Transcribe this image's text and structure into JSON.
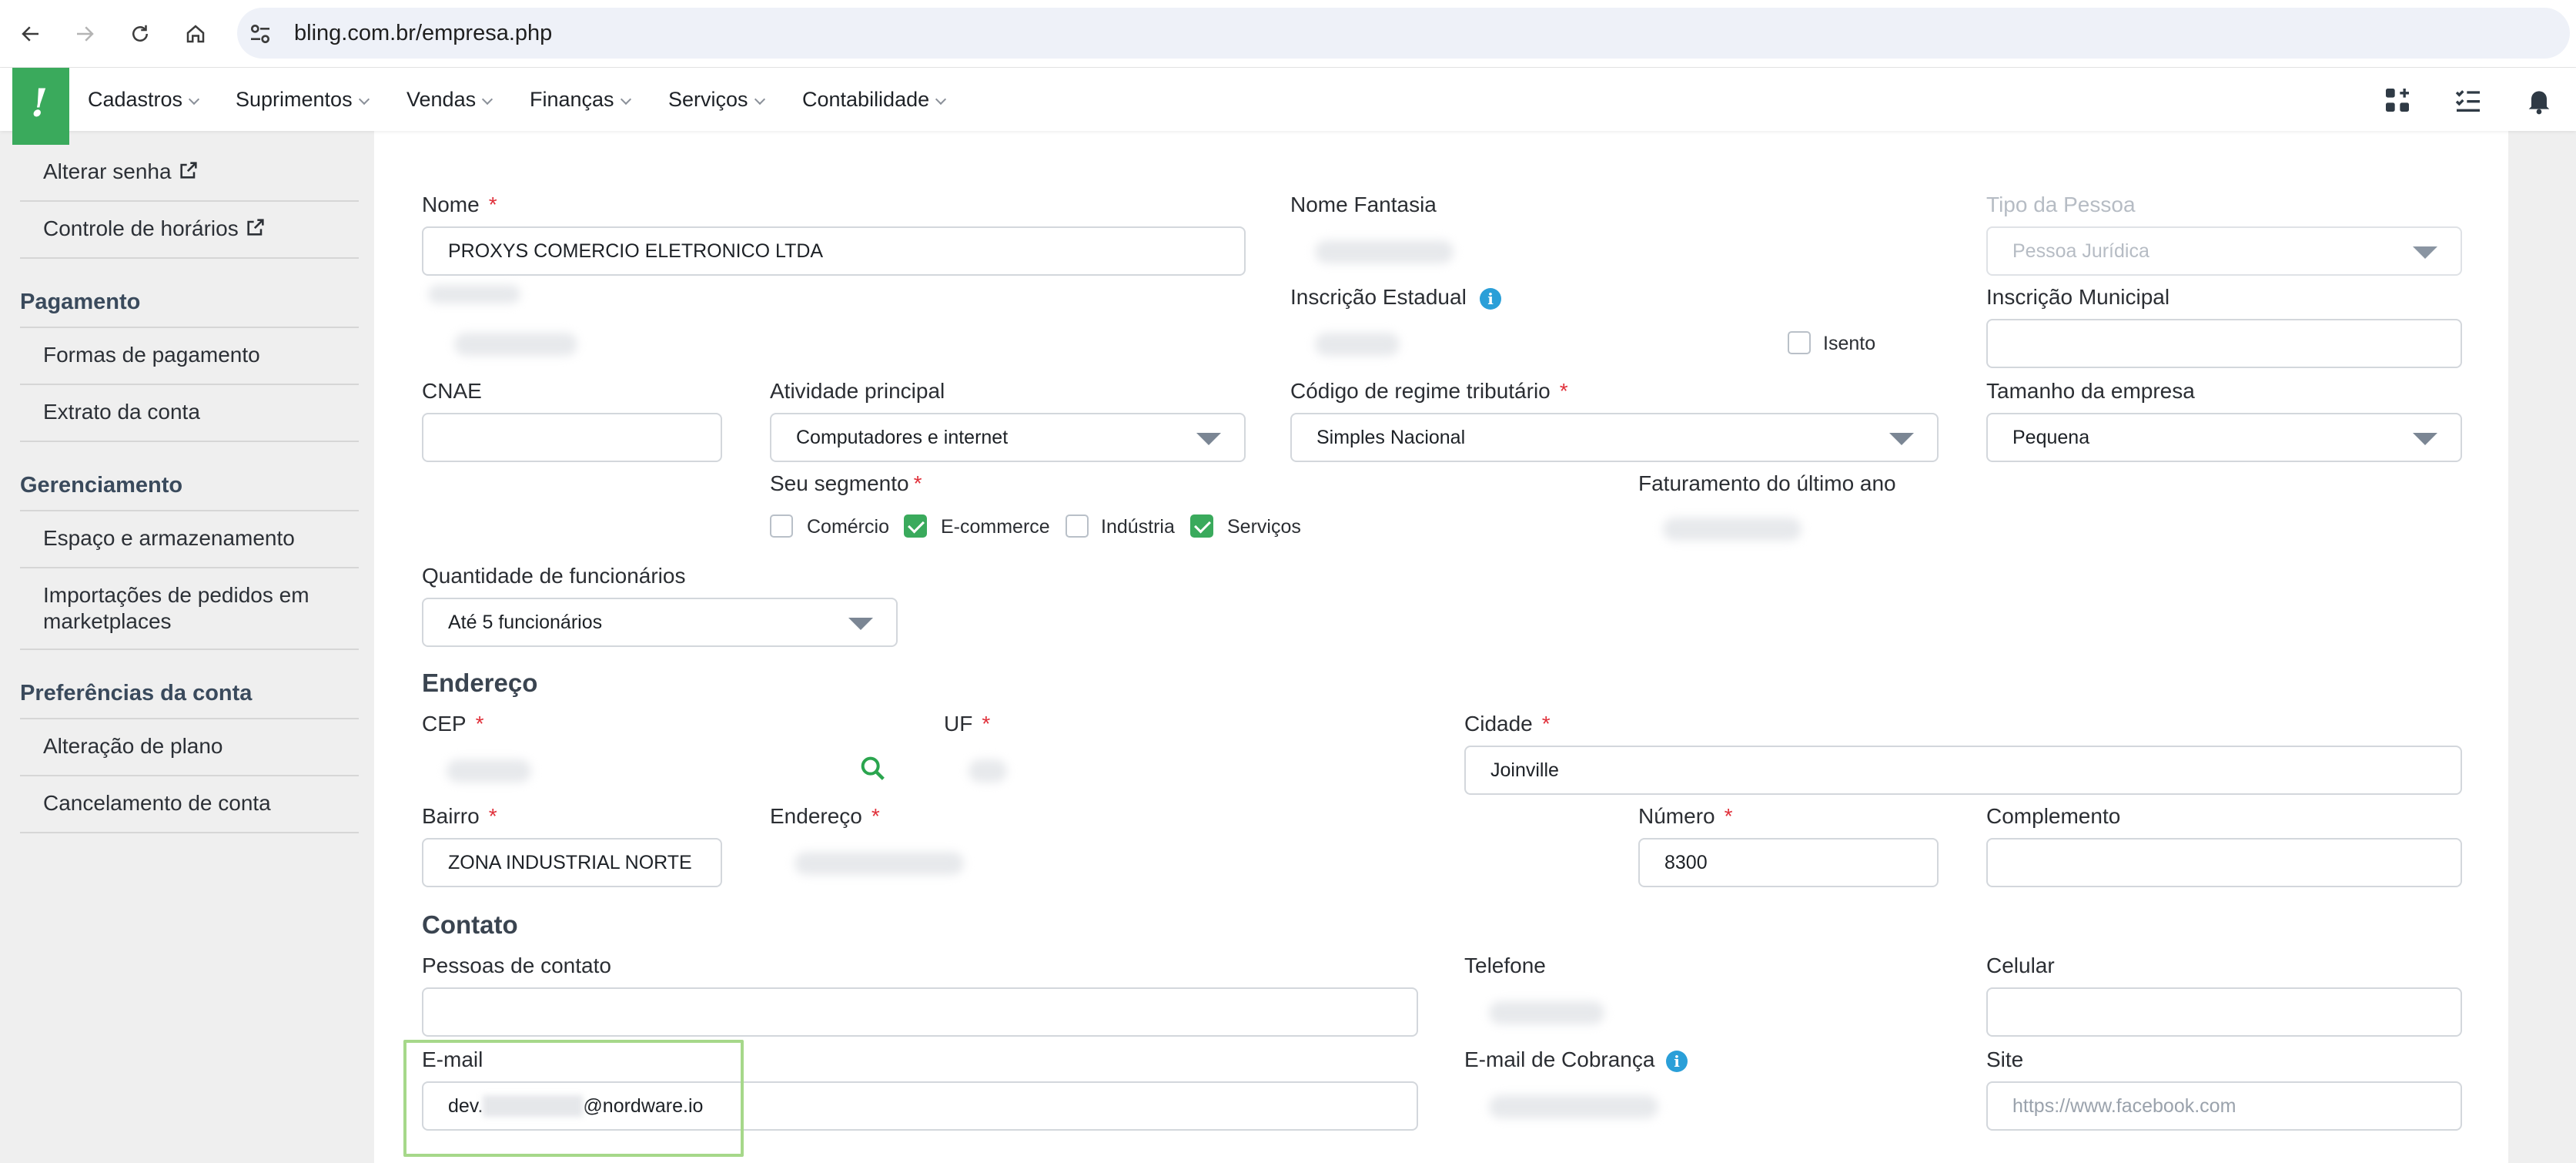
{
  "browser": {
    "url": "bling.com.br/empresa.php"
  },
  "nav": {
    "menu": [
      "Cadastros",
      "Suprimentos",
      "Vendas",
      "Finanças",
      "Serviços",
      "Contabilidade"
    ],
    "accent": "#3aaa5c"
  },
  "sidebar": {
    "items_top": [
      "Alterar senha",
      "Controle de horários"
    ],
    "pagamento": {
      "heading": "Pagamento",
      "items": [
        "Formas de pagamento",
        "Extrato da conta"
      ]
    },
    "gerenciamento": {
      "heading": "Gerenciamento",
      "items": [
        "Espaço e armazenamento",
        "Importações de pedidos em",
        "marketplaces"
      ]
    },
    "preferencias": {
      "heading": "Preferências da conta",
      "items": [
        "Alteração de plano",
        "Cancelamento de conta"
      ]
    }
  },
  "form": {
    "required_mark": "*",
    "nome": {
      "label": "Nome",
      "value": "PROXYS COMERCIO ELETRONICO LTDA"
    },
    "nome_fantasia": {
      "label": "Nome Fantasia"
    },
    "tipo_pessoa": {
      "label": "Tipo da Pessoa",
      "value": "Pessoa Jurídica"
    },
    "inscricao_estadual": {
      "label": "Inscrição Estadual",
      "isento_label": "Isento",
      "isento_checked": false
    },
    "inscricao_municipal": {
      "label": "Inscrição Municipal",
      "value": ""
    },
    "cnae": {
      "label": "CNAE",
      "value": ""
    },
    "atividade": {
      "label": "Atividade principal",
      "value": "Computadores e internet"
    },
    "regime": {
      "label": "Código de regime tributário",
      "value": "Simples Nacional"
    },
    "tamanho": {
      "label": "Tamanho da empresa",
      "value": "Pequena"
    },
    "segmento": {
      "label": "Seu segmento",
      "options": [
        {
          "label": "Comércio",
          "checked": false
        },
        {
          "label": "E-commerce",
          "checked": true
        },
        {
          "label": "Indústria",
          "checked": false
        },
        {
          "label": "Serviços",
          "checked": true
        }
      ]
    },
    "faturamento": {
      "label": "Faturamento do último ano"
    },
    "funcionarios": {
      "label": "Quantidade de funcionários",
      "value": "Até 5 funcionários"
    }
  },
  "endereco": {
    "heading": "Endereço",
    "cep": {
      "label": "CEP"
    },
    "uf": {
      "label": "UF"
    },
    "cidade": {
      "label": "Cidade",
      "value": "Joinville"
    },
    "bairro": {
      "label": "Bairro",
      "value": "ZONA INDUSTRIAL NORTE"
    },
    "endereco": {
      "label": "Endereço"
    },
    "numero": {
      "label": "Número",
      "value": "8300"
    },
    "complemento": {
      "label": "Complemento",
      "value": ""
    }
  },
  "contato": {
    "heading": "Contato",
    "pessoas": {
      "label": "Pessoas de contato",
      "value": ""
    },
    "telefone": {
      "label": "Telefone"
    },
    "celular": {
      "label": "Celular",
      "value": ""
    },
    "email": {
      "label": "E-mail",
      "value_prefix": "dev.",
      "value_suffix": "@nordware.io"
    },
    "email_cobranca": {
      "label": "E-mail de Cobrança"
    },
    "site": {
      "label": "Site",
      "placeholder": "https://www.facebook.com"
    }
  }
}
